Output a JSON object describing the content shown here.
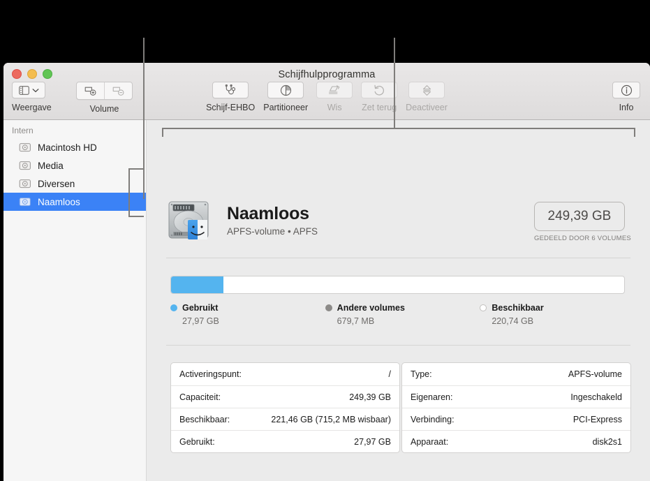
{
  "window": {
    "title": "Schijfhulpprogramma",
    "traffic_lights": [
      "close-button",
      "minimize-button",
      "zoom-button"
    ]
  },
  "toolbar": {
    "view": {
      "label": "Weergave",
      "icon": "sidebar-icon",
      "chevron": "chevron-down-icon"
    },
    "volume": {
      "label": "Volume",
      "add_icon": "add-volume-icon",
      "remove_icon": "remove-volume-icon"
    },
    "actions": [
      {
        "label": "Schijf-EHBO",
        "icon": "stethoscope-icon",
        "enabled": true
      },
      {
        "label": "Partitioneer",
        "icon": "partition-pie-icon",
        "enabled": true
      },
      {
        "label": "Wis",
        "icon": "erase-icon",
        "enabled": false
      },
      {
        "label": "Zet terug",
        "icon": "restore-undo-icon",
        "enabled": false
      },
      {
        "label": "Deactiveer",
        "icon": "eject-unmount-icon",
        "enabled": false
      }
    ],
    "info": {
      "label": "Info",
      "icon": "info-circle-icon"
    }
  },
  "sidebar": {
    "section_header": "Intern",
    "items": [
      {
        "label": "Macintosh HD",
        "icon": "internal-disk-icon",
        "selected": false
      },
      {
        "label": "Media",
        "icon": "internal-disk-icon",
        "selected": false
      },
      {
        "label": "Diversen",
        "icon": "internal-disk-icon",
        "selected": false
      },
      {
        "label": "Naamloos",
        "icon": "internal-disk-icon",
        "selected": true
      }
    ]
  },
  "detail": {
    "device_icon": "hard-disk-with-finder-badge-icon",
    "name": "Naamloos",
    "subtitle": "APFS-volume • APFS",
    "capacity_pill": "249,39 GB",
    "capacity_caption": "GEDEELD DOOR 6 VOLUMES",
    "usage_bar": {
      "used_percent": 11.5,
      "used_color": "#54b4ef"
    },
    "legend": [
      {
        "name": "Gebruikt",
        "value": "27,97 GB",
        "color": "#54b4ef",
        "dot": "filled"
      },
      {
        "name": "Andere volumes",
        "value": "679,7 MB",
        "color": "#8c8a88",
        "dot": "filled"
      },
      {
        "name": "Beschikbaar",
        "value": "220,74 GB",
        "color": "#ffffff",
        "dot": "outline"
      }
    ],
    "table_left": [
      {
        "key": "Activeringspunt:",
        "value": "/"
      },
      {
        "key": "Capaciteit:",
        "value": "249,39 GB"
      },
      {
        "key": "Beschikbaar:",
        "value": "221,46 GB (715,2 MB wisbaar)"
      },
      {
        "key": "Gebruikt:",
        "value": "27,97 GB"
      }
    ],
    "table_right": [
      {
        "key": "Type:",
        "value": "APFS-volume"
      },
      {
        "key": "Eigenaren:",
        "value": "Ingeschakeld"
      },
      {
        "key": "Verbinding:",
        "value": "PCI-Express"
      },
      {
        "key": "Apparaat:",
        "value": "disk2s1"
      }
    ]
  },
  "callouts": {
    "line_color": "#7f7d7b",
    "left_target": "sidebar-item-naamloos",
    "right_target": "volume-detail-pane"
  }
}
